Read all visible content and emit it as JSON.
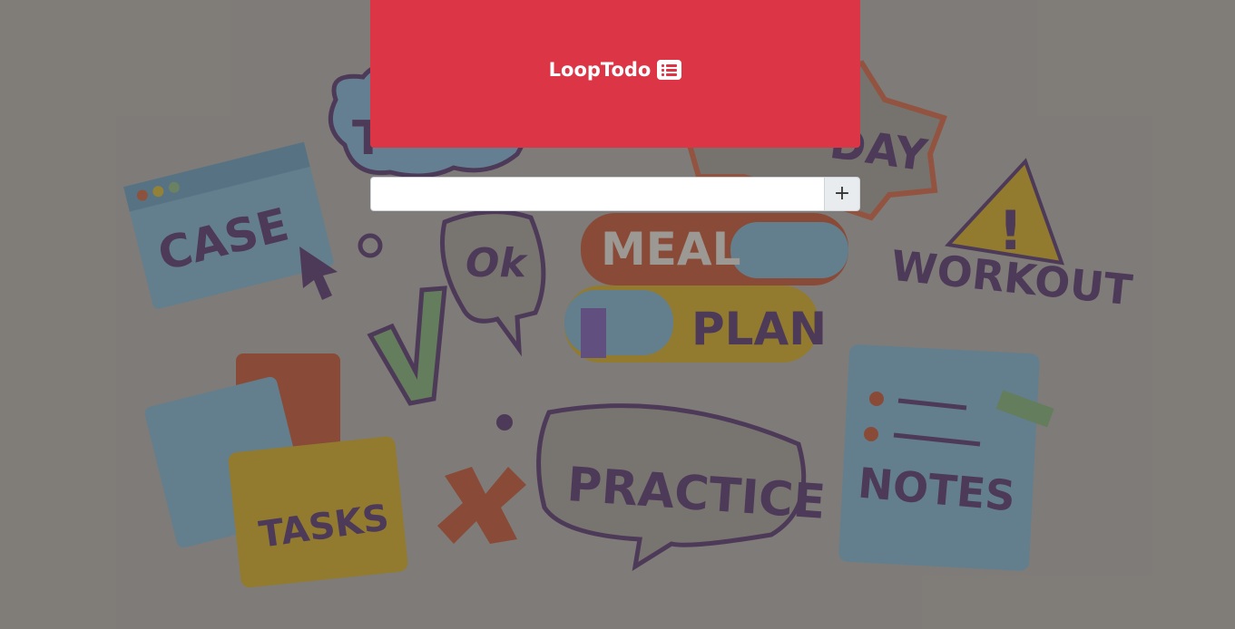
{
  "header": {
    "title": "LoopTodo",
    "icon": "list-icon",
    "background_color": "#dc3545"
  },
  "todo_form": {
    "input_value": "",
    "input_placeholder": "",
    "add_button_label": "+"
  },
  "background": {
    "words": {
      "case": "CASE",
      "ok": "Ok",
      "meal": "MEAL",
      "plan": "PLAN",
      "workout": "WORKOUT",
      "tasks": "TASKS",
      "practice": "PRACTICE",
      "notes": "NOTES",
      "today_partial": "DAY",
      "to_partial": "T"
    }
  }
}
